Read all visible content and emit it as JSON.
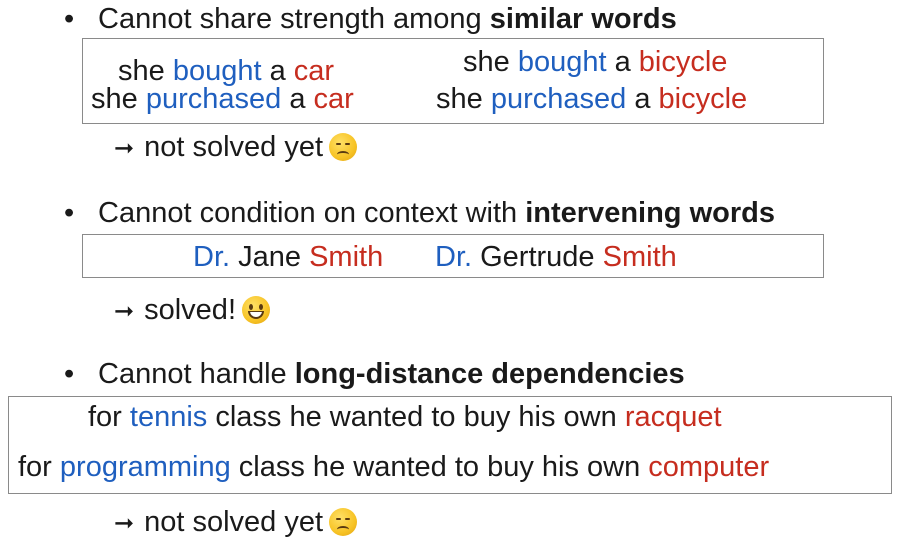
{
  "bullet_char": "•",
  "arrow_char": "➞",
  "sections": [
    {
      "bullet": {
        "prefix": "Cannot share strength among ",
        "bold": "similar words"
      },
      "examples": {
        "ex1": {
          "w1": "she ",
          "w2": "bought",
          "w3": " a ",
          "w4": "car"
        },
        "ex2": {
          "w1": "she ",
          "w2": "purchased",
          "w3": " a ",
          "w4": "car"
        },
        "ex3": {
          "w1": "she ",
          "w2": "bought",
          "w3": " a ",
          "w4": "bicycle"
        },
        "ex4": {
          "w1": "she ",
          "w2": "purchased",
          "w3": " a ",
          "w4": "bicycle"
        }
      },
      "result": {
        "text": "not solved yet",
        "emoji": "sad-face-emoji"
      }
    },
    {
      "bullet": {
        "prefix": "Cannot condition on context with ",
        "bold": "intervening words"
      },
      "examples": {
        "ex1": {
          "w1": "Dr.",
          "w2": " Jane ",
          "w3": "Smith"
        },
        "ex2": {
          "w1": "Dr.",
          "w2": " Gertrude ",
          "w3": "Smith"
        }
      },
      "result": {
        "text": "solved!",
        "emoji": "grinning-face-emoji"
      }
    },
    {
      "bullet": {
        "prefix": "Cannot handle ",
        "bold": "long-distance dependencies"
      },
      "examples": {
        "ex1": {
          "w1": "for ",
          "w2": "tennis",
          "w3": " class he wanted to buy his own ",
          "w4": "racquet"
        },
        "ex2": {
          "w1": "for ",
          "w2": "programming",
          "w3": " class he wanted to buy his own ",
          "w4": "computer"
        }
      },
      "result": {
        "text": "not solved yet",
        "emoji": "sad-face-emoji"
      }
    }
  ],
  "colors": {
    "highlight_blue": "#1f5fbf",
    "highlight_red": "#c62d1f",
    "box_border": "#8a8a8a"
  }
}
